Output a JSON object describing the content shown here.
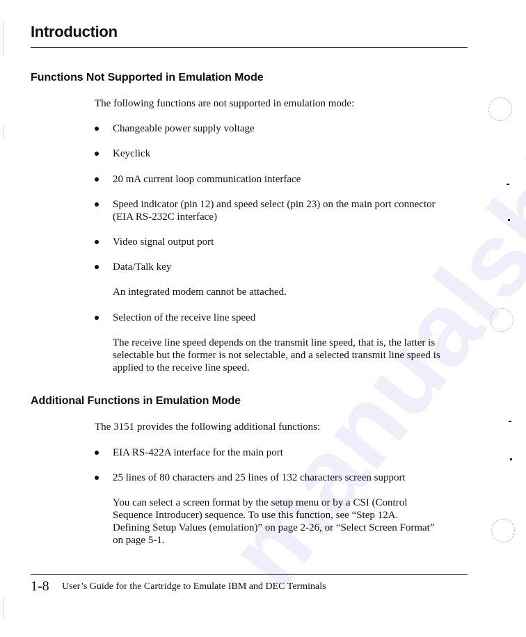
{
  "chapter_title": "Introduction",
  "watermark": "manualshive.com",
  "sections": [
    {
      "heading": "Functions Not Supported in Emulation Mode",
      "intro": "The following functions are not supported in emulation mode:",
      "items": [
        {
          "text": "Changeable power supply voltage"
        },
        {
          "text": "Keyclick"
        },
        {
          "text": "20 mA current loop communication interface"
        },
        {
          "text": "Speed indicator (pin 12) and speed select (pin 23) on the main port connector",
          "text2": "(EIA RS-232C interface)"
        },
        {
          "text": "Video signal output port"
        },
        {
          "text": "Data/Talk key",
          "note": "An integrated modem cannot be attached."
        },
        {
          "text": "Selection of the receive line speed",
          "note_lines": [
            "The receive line speed depends on the transmit line speed, that is, the latter is",
            "selectable but the former is not selectable, and a selected transmit line speed is",
            "applied to the receive line speed."
          ]
        }
      ]
    },
    {
      "heading": "Additional Functions in Emulation Mode",
      "intro": "The 3151 provides the following additional functions:",
      "items": [
        {
          "text": "EIA RS-422A interface for the main port"
        },
        {
          "text": "25 lines of 80 characters and 25 lines of 132 characters screen support",
          "note_lines": [
            "You can select a screen format by the setup menu or by a CSI (Control",
            "Sequence Introducer) sequence.  To use this function, see “Step 12A.",
            "Defining Setup Values (emulation)” on page 2-26, or “Select Screen Format”",
            "on page  5-1."
          ]
        }
      ]
    }
  ],
  "footer": {
    "page_number": "1-8",
    "book_title": "User’s Guide for the Cartridge to Emulate IBM and DEC Terminals"
  }
}
